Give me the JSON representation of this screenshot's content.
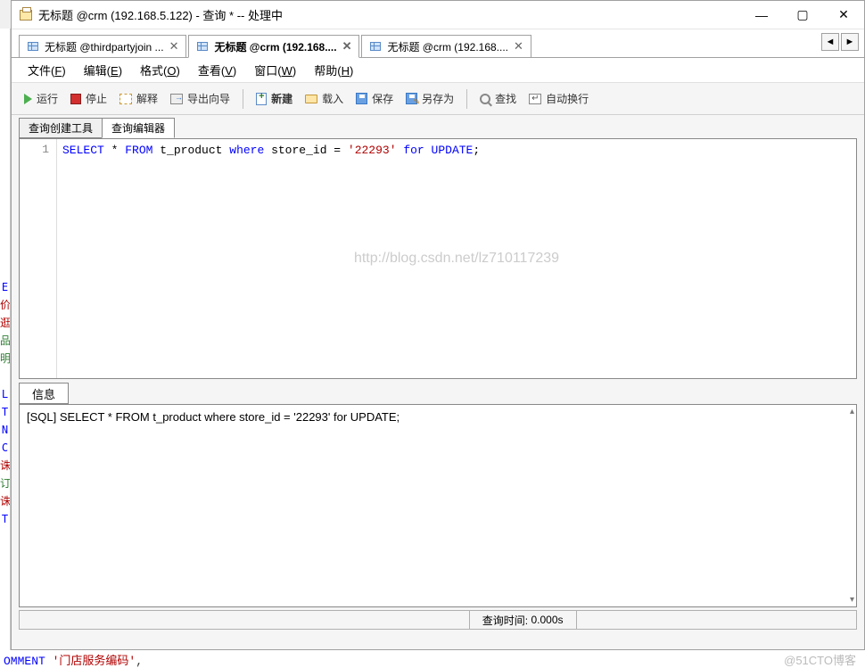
{
  "window": {
    "title": "无标题 @crm (192.168.5.122) - 查询 * -- 处理中"
  },
  "doc_tabs": [
    {
      "label": "无标题 @thirdpartyjoin ...",
      "active": false
    },
    {
      "label": "无标题 @crm (192.168....",
      "active": true
    },
    {
      "label": "无标题 @crm (192.168....",
      "active": false
    }
  ],
  "menus": [
    {
      "label": "文件",
      "key": "F"
    },
    {
      "label": "编辑",
      "key": "E"
    },
    {
      "label": "格式",
      "key": "O"
    },
    {
      "label": "查看",
      "key": "V"
    },
    {
      "label": "窗口",
      "key": "W"
    },
    {
      "label": "帮助",
      "key": "H"
    }
  ],
  "toolbar": {
    "run": "运行",
    "stop": "停止",
    "explain": "解释",
    "export": "导出向导",
    "new": "新建",
    "load": "载入",
    "save": "保存",
    "saveas": "另存为",
    "find": "查找",
    "wrap": "自动换行"
  },
  "editor_tabs": {
    "builder": "查询创建工具",
    "editor": "查询编辑器"
  },
  "editor": {
    "line_number": "1",
    "sql_tokens": {
      "t0": "SELECT",
      "t1": " * ",
      "t2": "FROM",
      "t3": " t_product ",
      "t4": "where",
      "t5": " store_id = ",
      "t6": "'22293'",
      "t7": " ",
      "t8": "for",
      "t9": " ",
      "t10": "UPDATE",
      "t11": ";"
    },
    "watermark": "http://blog.csdn.net/lz710117239"
  },
  "info_panel": {
    "tab": "信息",
    "content": "[SQL] SELECT * FROM t_product where store_id = '22293' for UPDATE;"
  },
  "status": {
    "query_time_label": "查询时间:",
    "query_time_value": "0.000s"
  },
  "bg_bottom": {
    "kw": "OMMENT",
    "str": "'门店服务编码'",
    "tail": ",",
    "watermark": "@51CTO博客"
  },
  "left_strip": [
    "",
    "E",
    "价",
    "逛",
    "品",
    "明",
    "",
    "L",
    "T",
    "N",
    "C",
    "诛",
    "订",
    "诛",
    "T"
  ]
}
